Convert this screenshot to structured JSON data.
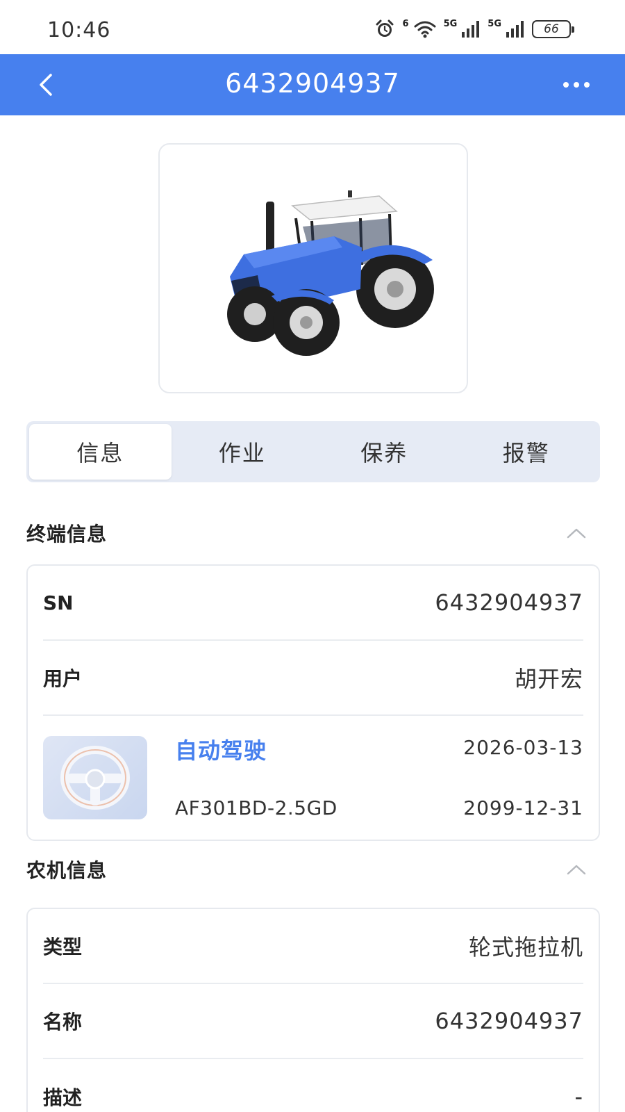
{
  "status_bar": {
    "time": "10:46",
    "wifi_label": "6",
    "network_1": "5G",
    "network_2": "5G",
    "battery": "66",
    "icons": [
      "alarm-icon",
      "wifi-icon",
      "signal-icon",
      "signal-icon",
      "battery-icon"
    ]
  },
  "header": {
    "title": "6432904937",
    "back_icon": "chevron-left-icon",
    "more_icon": "more-horizontal-icon",
    "color": "#4780EE"
  },
  "product_image": {
    "alt": "tractor-image",
    "body_color": "#3E6FE0"
  },
  "tabs": [
    {
      "label": "信息",
      "active": true
    },
    {
      "label": "作业",
      "active": false
    },
    {
      "label": "保养",
      "active": false
    },
    {
      "label": "报警",
      "active": false
    }
  ],
  "terminal_section": {
    "title": "终端信息",
    "expanded": true,
    "rows": [
      {
        "label": "SN",
        "value": "6432904937"
      },
      {
        "label": "用户",
        "value": "胡开宏"
      }
    ],
    "device": {
      "icon": "steering-wheel-icon",
      "name": "自动驾驶",
      "model": "AF301BD-2.5GD",
      "start_date": "2026-03-13",
      "end_date": "2099-12-31"
    }
  },
  "machine_section": {
    "title": "农机信息",
    "expanded": true,
    "rows": [
      {
        "label": "类型",
        "value": "轮式拖拉机"
      },
      {
        "label": "名称",
        "value": "6432904937"
      },
      {
        "label": "描述",
        "value": "-"
      }
    ]
  }
}
